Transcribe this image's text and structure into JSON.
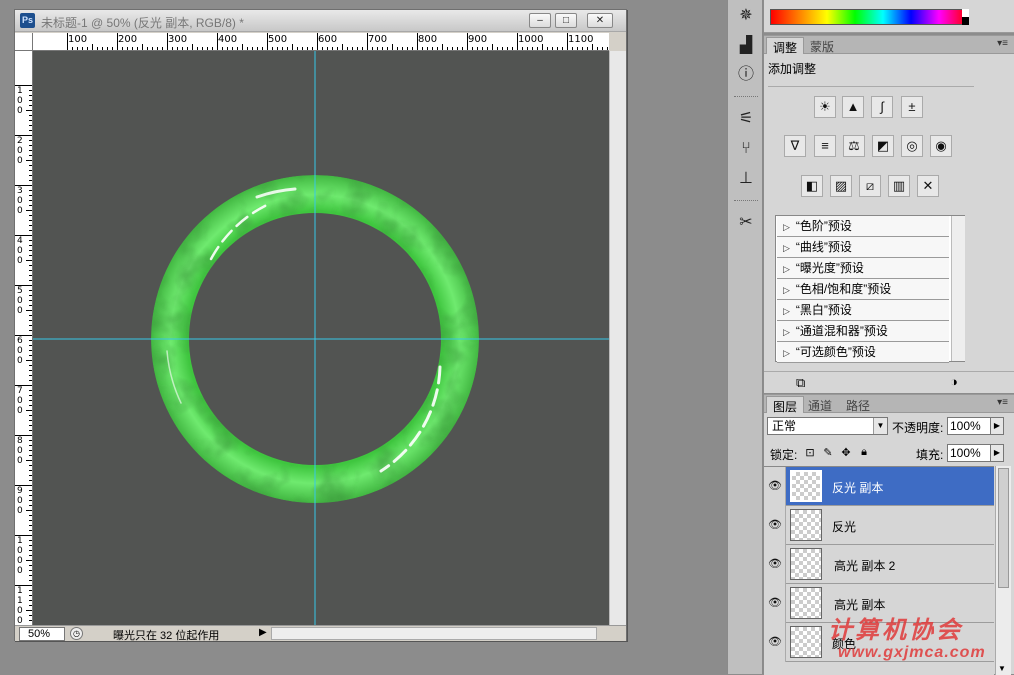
{
  "document": {
    "title": "未标题-1 @ 50% (反光 副本, RGB/8) *",
    "app_badge": "Ps",
    "window_buttons": {
      "minimize": "–",
      "restore": "□",
      "close": "✕"
    },
    "ruler_h_labels": [
      "100",
      "200",
      "300",
      "400",
      "500",
      "600",
      "700",
      "800",
      "900",
      "1000",
      "1100"
    ],
    "ruler_v_labels": [
      "100",
      "200",
      "300",
      "400",
      "500",
      "600",
      "700",
      "800",
      "900",
      "1000",
      "1100"
    ],
    "zoom": "50%",
    "status_text": "曝光只在 32 位起作用",
    "colors": {
      "canvas": "#525452",
      "guide": "#36c8e8",
      "jade_light": "#7af07a",
      "jade_dark": "#1f7a1f"
    }
  },
  "dock": {
    "icons": [
      "navigator-icon",
      "histogram-icon",
      "info-icon",
      "brushes-icon",
      "clone-source-icon",
      "tool-presets-icon",
      "tools-icon"
    ]
  },
  "adjustments_panel": {
    "tabs": [
      "调整",
      "蒙版"
    ],
    "heading": "添加调整",
    "menu_glyph": "▾≡",
    "presets": [
      "“色阶”预设",
      "“曲线”预设",
      "“曝光度”预设",
      "“色相/饱和度”预设",
      "“黑白”预设",
      "“通道混和器”预设",
      "“可选颜色”预设"
    ]
  },
  "layers_panel": {
    "tabs": [
      "图层",
      "通道",
      "路径"
    ],
    "blend_mode": "正常",
    "opacity_label": "不透明度:",
    "opacity_value": "100%",
    "lock_label": "锁定:",
    "fill_label": "填充:",
    "fill_value": "100%",
    "layers": [
      {
        "name": "反光 副本",
        "selected": true
      },
      {
        "name": "反光",
        "selected": false
      },
      {
        "name": "高光 副本 2",
        "selected": false
      },
      {
        "name": "高光 副本",
        "selected": false
      },
      {
        "name": "颜色",
        "selected": false
      }
    ]
  },
  "watermark": {
    "text": "计算机协会",
    "url": "www.gxjmca.com"
  }
}
